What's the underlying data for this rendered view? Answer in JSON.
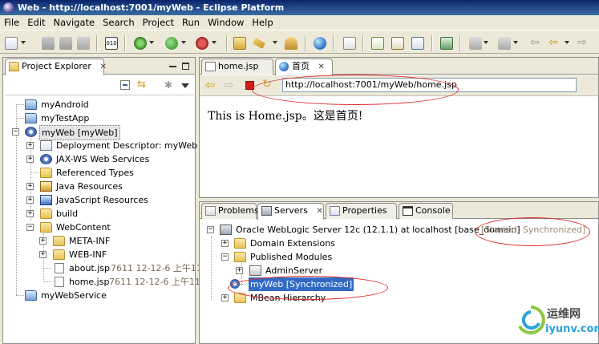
{
  "window": {
    "title": "Web - http://localhost:7001/myWeb - Eclipse Platform"
  },
  "menu": [
    "File",
    "Edit",
    "Navigate",
    "Search",
    "Project",
    "Run",
    "Window",
    "Help"
  ],
  "project_explorer": {
    "title": "Project Explorer",
    "items": [
      {
        "label": "myAndroid"
      },
      {
        "label": "myTestApp"
      },
      {
        "label": "myWeb [myWeb]"
      },
      {
        "label": "Deployment Descriptor: myWeb"
      },
      {
        "label": "JAX-WS Web Services"
      },
      {
        "label": "Referenced Types"
      },
      {
        "label": "Java Resources"
      },
      {
        "label": "JavaScript Resources"
      },
      {
        "label": "build"
      },
      {
        "label": "WebContent"
      },
      {
        "label": "META-INF"
      },
      {
        "label": "WEB-INF"
      },
      {
        "label": "about.jsp",
        "meta": "7611  12-12-6 上午11"
      },
      {
        "label": "home.jsp",
        "meta": "7611  12-12-6 上午11"
      },
      {
        "label": "myWebService"
      }
    ]
  },
  "editor": {
    "tabs": [
      {
        "label": "home.jsp"
      },
      {
        "label": "首页"
      }
    ],
    "url": "http://localhost:7001/myWeb/home.jsp",
    "content": "This is Home.jsp。这是首页!"
  },
  "bottom": {
    "tabs": [
      {
        "label": "Problems"
      },
      {
        "label": "Servers"
      },
      {
        "label": "Properties"
      },
      {
        "label": "Console"
      }
    ],
    "server": {
      "label": "Oracle WebLogic Server 12c (12.1.1) at localhost [base_domain]",
      "status": "[Started, Synchronized]",
      "children": [
        {
          "label": "Domain Extensions"
        },
        {
          "label": "Published Modules"
        },
        {
          "label": "AdminServer"
        },
        {
          "label": "myWeb  [Synchronized]"
        },
        {
          "label": "MBean Hierarchy"
        }
      ]
    }
  },
  "watermark": {
    "cn": "运维网",
    "url": "iyunv.com"
  }
}
